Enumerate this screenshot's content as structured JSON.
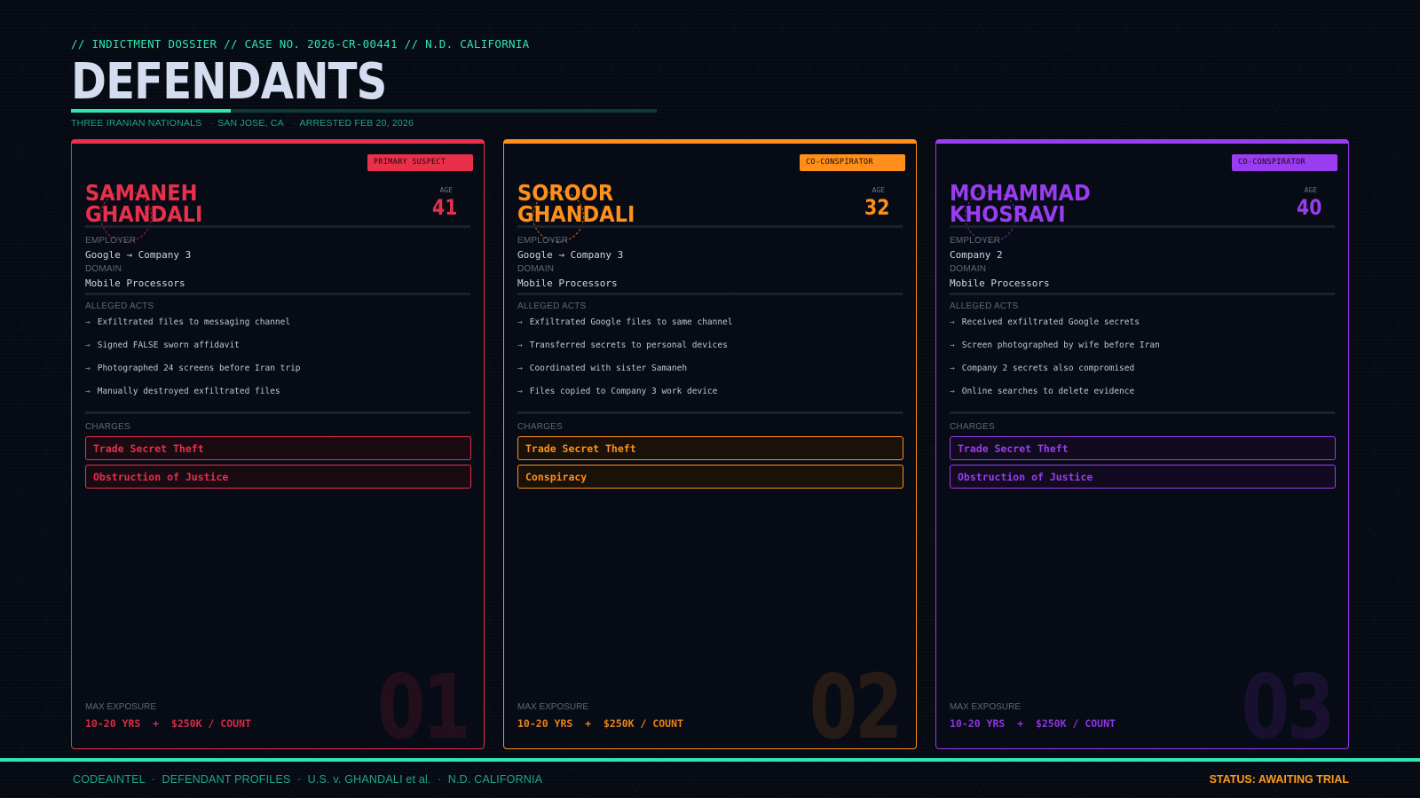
{
  "header": {
    "kicker": "// INDICTMENT DOSSIER  //  CASE NO. 2026-CR-00441  //  N.D. CALIFORNIA",
    "title": "DEFENDANTS",
    "subtitle": [
      "THREE IRANIAN NATIONALS",
      "SAN JOSE, CA",
      "ARRESTED FEB 20, 2026"
    ],
    "subtitle_sep": "·"
  },
  "labels": {
    "age": "AGE",
    "employer": "EMPLOYER",
    "domain": "DOMAIN",
    "alleged_acts": "ALLEGED ACTS",
    "charges": "CHARGES",
    "max_exposure": "MAX EXPOSURE",
    "act_arrow": "→"
  },
  "defendants": [
    {
      "number": "01",
      "badge": "PRIMARY SUSPECT",
      "first_name": "SAMANEH",
      "last_name": "GHANDALI",
      "age": "41",
      "employer": "Google → Company 3",
      "domain": "Mobile Processors",
      "acts": [
        "Exfiltrated files to messaging channel",
        "Signed FALSE sworn affidavit",
        "Photographed 24 screens before Iran trip",
        "Manually destroyed exfiltrated files"
      ],
      "charges": [
        "Trade Secret Theft",
        "Obstruction of Justice"
      ],
      "exposure": "10-20 YRS  +  $250K / COUNT",
      "color": "#e8304a",
      "charge_bg": "#1a0a12"
    },
    {
      "number": "02",
      "badge": "CO-CONSPIRATOR",
      "first_name": "SOROOR",
      "last_name": "GHANDALI",
      "age": "32",
      "employer": "Google → Company 3",
      "domain": "Mobile Processors",
      "acts": [
        "Exfiltrated Google files to same channel",
        "Transferred secrets to personal devices",
        "Coordinated with sister Samaneh",
        "Files copied to Company 3 work device"
      ],
      "charges": [
        "Trade Secret Theft",
        "Conspiracy"
      ],
      "exposure": "10-20 YRS  +  $250K / COUNT",
      "color": "#ff8f1a",
      "charge_bg": "#1a1108"
    },
    {
      "number": "03",
      "badge": "CO-CONSPIRATOR",
      "first_name": "MOHAMMAD",
      "last_name": "KHOSRAVI",
      "age": "40",
      "employer": "Company 2",
      "domain": "Mobile Processors",
      "acts": [
        "Received exfiltrated Google secrets",
        "Screen photographed by wife before Iran",
        "Company 2 secrets also compromised",
        "Online searches to delete evidence"
      ],
      "charges": [
        "Trade Secret Theft",
        "Obstruction of Justice"
      ],
      "exposure": "10-20 YRS  +  $250K / COUNT",
      "color": "#9a3cf0",
      "charge_bg": "#120a20"
    }
  ],
  "footer": {
    "left": "CODEAINTEL  ·  DEFENDANT PROFILES  ·  U.S. v. GHANDALI et al.  ·  N.D. CALIFORNIA",
    "right": "STATUS: AWAITING TRIAL"
  }
}
